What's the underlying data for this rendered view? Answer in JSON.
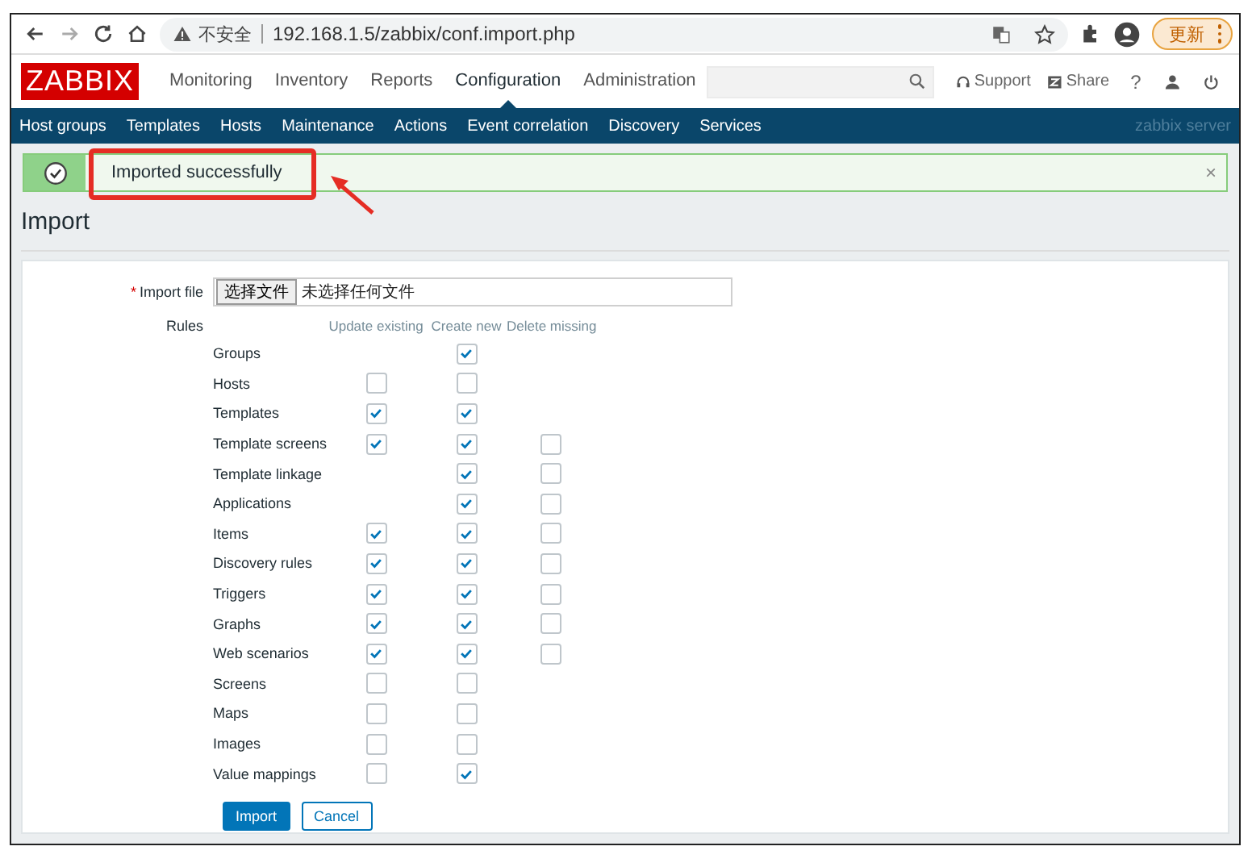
{
  "browser": {
    "security": "不安全",
    "url": "192.168.1.5/zabbix/conf.import.php",
    "update_button": "更新"
  },
  "header": {
    "logo": "ZABBIX",
    "menu": [
      {
        "label": "Monitoring",
        "selected": false
      },
      {
        "label": "Inventory",
        "selected": false
      },
      {
        "label": "Reports",
        "selected": false
      },
      {
        "label": "Configuration",
        "selected": true
      },
      {
        "label": "Administration",
        "selected": false
      }
    ],
    "support": "Support",
    "share": "Share",
    "help": "?"
  },
  "submenu": {
    "items": [
      "Host groups",
      "Templates",
      "Hosts",
      "Maintenance",
      "Actions",
      "Event correlation",
      "Discovery",
      "Services"
    ],
    "server": "zabbix server"
  },
  "message": {
    "text": "Imported successfully",
    "close": "×"
  },
  "page_title": "Import",
  "form": {
    "required_mark": "*",
    "import_file_label": "Import file",
    "file_button": "选择文件",
    "file_status": "未选择任何文件",
    "rules_label": "Rules",
    "columns": [
      "Update existing",
      "Create new",
      "Delete missing"
    ],
    "rules": [
      {
        "name": "Groups",
        "create_new": true
      },
      {
        "name": "Hosts",
        "update_existing": false,
        "create_new": false
      },
      {
        "name": "Templates",
        "update_existing": true,
        "create_new": true
      },
      {
        "name": "Template screens",
        "update_existing": true,
        "create_new": true,
        "delete_missing": false
      },
      {
        "name": "Template linkage",
        "create_new": true,
        "delete_missing": false
      },
      {
        "name": "Applications",
        "create_new": true,
        "delete_missing": false
      },
      {
        "name": "Items",
        "update_existing": true,
        "create_new": true,
        "delete_missing": false
      },
      {
        "name": "Discovery rules",
        "update_existing": true,
        "create_new": true,
        "delete_missing": false
      },
      {
        "name": "Triggers",
        "update_existing": true,
        "create_new": true,
        "delete_missing": false
      },
      {
        "name": "Graphs",
        "update_existing": true,
        "create_new": true,
        "delete_missing": false
      },
      {
        "name": "Web scenarios",
        "update_existing": true,
        "create_new": true,
        "delete_missing": false
      },
      {
        "name": "Screens",
        "update_existing": false,
        "create_new": false
      },
      {
        "name": "Maps",
        "update_existing": false,
        "create_new": false
      },
      {
        "name": "Images",
        "update_existing": false,
        "create_new": false
      },
      {
        "name": "Value mappings",
        "update_existing": false,
        "create_new": true
      }
    ],
    "buttons": [
      "Import",
      "Cancel"
    ]
  }
}
